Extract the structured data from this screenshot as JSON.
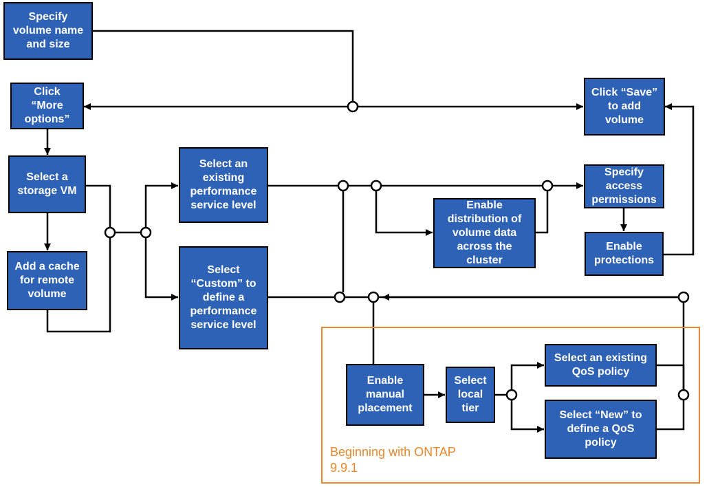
{
  "nodes": {
    "specify_volume": "Specify volume name and size",
    "more_options": "Click “More options”",
    "save_volume": "Click “Save” to add volume",
    "select_svm": "Select a storage VM",
    "add_cache": "Add a cache for remote volume",
    "select_existing_psl": "Select an existing performance service level",
    "select_custom_psl": "Select “Custom” to define a performance service level",
    "specify_permissions": "Specify access permissions",
    "enable_distribution": "Enable distribution of volume data across the cluster",
    "enable_protections": "Enable protections",
    "enable_manual_placement": "Enable manual placement",
    "select_local_tier": "Select local tier",
    "select_existing_qos": "Select an existing QoS policy",
    "select_new_qos": "Select “New” to define a QoS policy"
  },
  "frame_label": "Beginning with ONTAP 9.9.1",
  "colors": {
    "node_fill": "#2E62B7",
    "node_border": "#000000",
    "frame": "#E8872B"
  }
}
